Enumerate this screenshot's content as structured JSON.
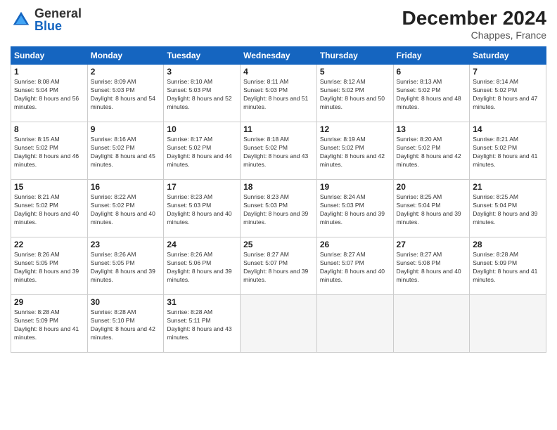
{
  "header": {
    "logo": {
      "general": "General",
      "blue": "Blue"
    },
    "title": "December 2024",
    "location": "Chappes, France"
  },
  "weekdays": [
    "Sunday",
    "Monday",
    "Tuesday",
    "Wednesday",
    "Thursday",
    "Friday",
    "Saturday"
  ],
  "weeks": [
    [
      {
        "day": 1,
        "sunrise": "8:08 AM",
        "sunset": "5:04 PM",
        "daylight": "8 hours and 56 minutes"
      },
      {
        "day": 2,
        "sunrise": "8:09 AM",
        "sunset": "5:03 PM",
        "daylight": "8 hours and 54 minutes"
      },
      {
        "day": 3,
        "sunrise": "8:10 AM",
        "sunset": "5:03 PM",
        "daylight": "8 hours and 52 minutes"
      },
      {
        "day": 4,
        "sunrise": "8:11 AM",
        "sunset": "5:03 PM",
        "daylight": "8 hours and 51 minutes"
      },
      {
        "day": 5,
        "sunrise": "8:12 AM",
        "sunset": "5:02 PM",
        "daylight": "8 hours and 50 minutes"
      },
      {
        "day": 6,
        "sunrise": "8:13 AM",
        "sunset": "5:02 PM",
        "daylight": "8 hours and 48 minutes"
      },
      {
        "day": 7,
        "sunrise": "8:14 AM",
        "sunset": "5:02 PM",
        "daylight": "8 hours and 47 minutes"
      }
    ],
    [
      {
        "day": 8,
        "sunrise": "8:15 AM",
        "sunset": "5:02 PM",
        "daylight": "8 hours and 46 minutes"
      },
      {
        "day": 9,
        "sunrise": "8:16 AM",
        "sunset": "5:02 PM",
        "daylight": "8 hours and 45 minutes"
      },
      {
        "day": 10,
        "sunrise": "8:17 AM",
        "sunset": "5:02 PM",
        "daylight": "8 hours and 44 minutes"
      },
      {
        "day": 11,
        "sunrise": "8:18 AM",
        "sunset": "5:02 PM",
        "daylight": "8 hours and 43 minutes"
      },
      {
        "day": 12,
        "sunrise": "8:19 AM",
        "sunset": "5:02 PM",
        "daylight": "8 hours and 42 minutes"
      },
      {
        "day": 13,
        "sunrise": "8:20 AM",
        "sunset": "5:02 PM",
        "daylight": "8 hours and 42 minutes"
      },
      {
        "day": 14,
        "sunrise": "8:21 AM",
        "sunset": "5:02 PM",
        "daylight": "8 hours and 41 minutes"
      }
    ],
    [
      {
        "day": 15,
        "sunrise": "8:21 AM",
        "sunset": "5:02 PM",
        "daylight": "8 hours and 40 minutes"
      },
      {
        "day": 16,
        "sunrise": "8:22 AM",
        "sunset": "5:02 PM",
        "daylight": "8 hours and 40 minutes"
      },
      {
        "day": 17,
        "sunrise": "8:23 AM",
        "sunset": "5:03 PM",
        "daylight": "8 hours and 40 minutes"
      },
      {
        "day": 18,
        "sunrise": "8:23 AM",
        "sunset": "5:03 PM",
        "daylight": "8 hours and 39 minutes"
      },
      {
        "day": 19,
        "sunrise": "8:24 AM",
        "sunset": "5:03 PM",
        "daylight": "8 hours and 39 minutes"
      },
      {
        "day": 20,
        "sunrise": "8:25 AM",
        "sunset": "5:04 PM",
        "daylight": "8 hours and 39 minutes"
      },
      {
        "day": 21,
        "sunrise": "8:25 AM",
        "sunset": "5:04 PM",
        "daylight": "8 hours and 39 minutes"
      }
    ],
    [
      {
        "day": 22,
        "sunrise": "8:26 AM",
        "sunset": "5:05 PM",
        "daylight": "8 hours and 39 minutes"
      },
      {
        "day": 23,
        "sunrise": "8:26 AM",
        "sunset": "5:05 PM",
        "daylight": "8 hours and 39 minutes"
      },
      {
        "day": 24,
        "sunrise": "8:26 AM",
        "sunset": "5:06 PM",
        "daylight": "8 hours and 39 minutes"
      },
      {
        "day": 25,
        "sunrise": "8:27 AM",
        "sunset": "5:07 PM",
        "daylight": "8 hours and 39 minutes"
      },
      {
        "day": 26,
        "sunrise": "8:27 AM",
        "sunset": "5:07 PM",
        "daylight": "8 hours and 40 minutes"
      },
      {
        "day": 27,
        "sunrise": "8:27 AM",
        "sunset": "5:08 PM",
        "daylight": "8 hours and 40 minutes"
      },
      {
        "day": 28,
        "sunrise": "8:28 AM",
        "sunset": "5:09 PM",
        "daylight": "8 hours and 41 minutes"
      }
    ],
    [
      {
        "day": 29,
        "sunrise": "8:28 AM",
        "sunset": "5:09 PM",
        "daylight": "8 hours and 41 minutes"
      },
      {
        "day": 30,
        "sunrise": "8:28 AM",
        "sunset": "5:10 PM",
        "daylight": "8 hours and 42 minutes"
      },
      {
        "day": 31,
        "sunrise": "8:28 AM",
        "sunset": "5:11 PM",
        "daylight": "8 hours and 43 minutes"
      },
      null,
      null,
      null,
      null
    ]
  ]
}
